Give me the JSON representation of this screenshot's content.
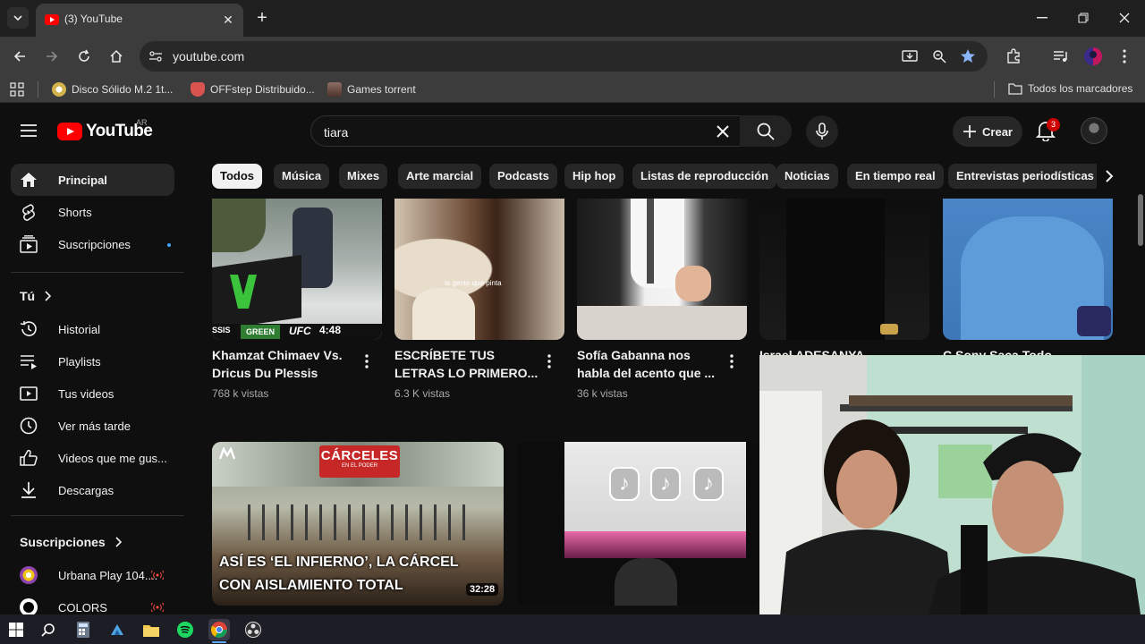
{
  "browser": {
    "tab_title": "(3) YouTube",
    "url": "youtube.com",
    "bookmarks": [
      {
        "label": "Disco Sólido M.2 1t..."
      },
      {
        "label": "OFFstep Distribuido..."
      },
      {
        "label": "Games torrent"
      }
    ],
    "all_bookmarks_label": "Todos los marcadores"
  },
  "youtube": {
    "logo_text": "YouTube",
    "country_code": "AR",
    "search_value": "tiara",
    "create_label": "Crear",
    "notification_count": "3"
  },
  "sidebar": {
    "main": [
      {
        "label": "Principal",
        "icon": "home-icon"
      },
      {
        "label": "Shorts",
        "icon": "shorts-icon"
      },
      {
        "label": "Suscripciones",
        "icon": "subscriptions-icon"
      }
    ],
    "you_header": "Tú",
    "you": [
      {
        "label": "Historial",
        "icon": "history-icon"
      },
      {
        "label": "Playlists",
        "icon": "playlists-icon"
      },
      {
        "label": "Tus videos",
        "icon": "your-videos-icon"
      },
      {
        "label": "Ver más tarde",
        "icon": "watch-later-icon"
      },
      {
        "label": "Videos que me gus...",
        "icon": "liked-icon"
      },
      {
        "label": "Descargas",
        "icon": "download-icon"
      }
    ],
    "subs_header": "Suscripciones",
    "subs": [
      {
        "label": "Urbana Play 104...."
      },
      {
        "label": "COLORS"
      }
    ]
  },
  "chips": [
    "Todos",
    "Música",
    "Mixes",
    "Arte marcial",
    "Podcasts",
    "Hip hop",
    "Listas de reproducción",
    "Noticias",
    "En tiempo real",
    "Entrevistas periodísticas"
  ],
  "videos": [
    {
      "title_l1": "Khamzat Chimaev Vs.",
      "title_l2": "Dricus Du Plessis",
      "meta": "768 k vistas",
      "duration": "4:48",
      "overlay_green": "GREEN",
      "overlay_ufc": "UFC",
      "overlay_ssis": "SSIS"
    },
    {
      "title_l1": "ESCRÍBETE TUS",
      "title_l2": "LETRAS LO PRIMERO...",
      "meta": "6.3 K vistas",
      "caption": "la gente que pinta"
    },
    {
      "title_l1": "Sofía Gabanna nos",
      "title_l2": "habla del acento que ...",
      "meta": "36 k vistas"
    },
    {
      "title_l1": "Israel ADESANYA"
    },
    {
      "title_l1": "C Sony Saca Todo"
    }
  ],
  "row2": [
    {
      "headline_l1": "ASÍ ES ‘EL INFIERNO’, LA CÁRCEL",
      "headline_l2": "CON AISLAMIENTO TOTAL",
      "badge": "CÁRCELES",
      "badge_sub": "EN EL PODER",
      "duration": "32:28"
    }
  ]
}
